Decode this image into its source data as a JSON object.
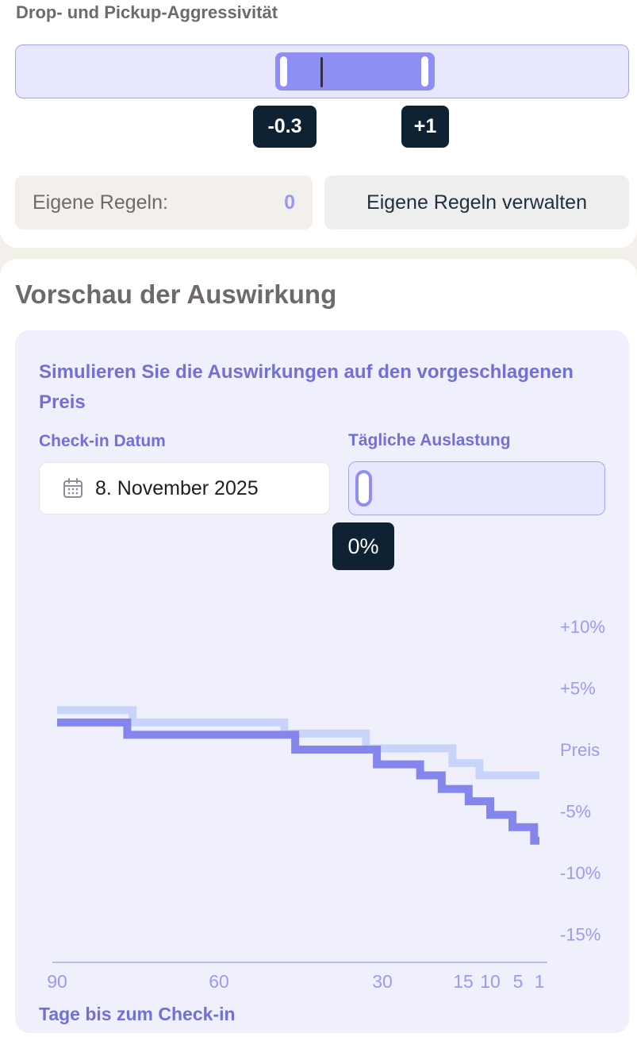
{
  "settings": {
    "aggressiveness_label": "Drop- und Pickup-Aggressivität",
    "range_min_value": "-0.3",
    "range_max_value": "+1",
    "custom_rules_label": "Eigene Regeln:",
    "custom_rules_count": "0",
    "manage_rules_button": "Eigene Regeln verwalten"
  },
  "preview": {
    "title": "Vorschau der Auswirkung",
    "heading": "Simulieren Sie die Auswirkungen auf den vorgeschlagenen Preis",
    "checkin_label": "Check-in Datum",
    "checkin_value": "8. November 2025",
    "calendar_icon": "calendar-icon",
    "occupancy_label": "Tägliche Auslastung",
    "occupancy_value": "0%",
    "occupancy_level": 0
  },
  "chart_data": {
    "type": "line",
    "xlabel": "Tage bis zum Check-in",
    "x_ticks": [
      "90",
      "60",
      "30",
      "15",
      "10",
      "5",
      "1"
    ],
    "y_ticks": [
      "+10%",
      "+5%",
      "Preis",
      "-5%",
      "-10%",
      "-15%"
    ],
    "x_domain": [
      90,
      1
    ],
    "ylim": [
      -15,
      10
    ],
    "series": [
      {
        "color": "#c9d4fb",
        "points": [
          [
            90,
            3.2
          ],
          [
            76,
            3.2
          ],
          [
            76,
            2.2
          ],
          [
            48,
            2.2
          ],
          [
            48,
            1.3
          ],
          [
            33,
            1.3
          ],
          [
            33,
            0.1
          ],
          [
            17,
            0.1
          ],
          [
            17,
            -1.1
          ],
          [
            12,
            -1.1
          ],
          [
            12,
            -2.1
          ],
          [
            1,
            -2.1
          ]
        ]
      },
      {
        "color": "#8585ee",
        "points": [
          [
            90,
            2.2
          ],
          [
            77,
            2.2
          ],
          [
            77,
            1.2
          ],
          [
            46,
            1.2
          ],
          [
            46,
            0.0
          ],
          [
            31,
            0.0
          ],
          [
            31,
            -1.2
          ],
          [
            23,
            -1.2
          ],
          [
            23,
            -2.1
          ],
          [
            19,
            -2.1
          ],
          [
            19,
            -3.2
          ],
          [
            14,
            -3.2
          ],
          [
            14,
            -4.2
          ],
          [
            10,
            -4.2
          ],
          [
            10,
            -5.3
          ],
          [
            6,
            -5.3
          ],
          [
            6,
            -6.3
          ],
          [
            2,
            -6.3
          ],
          [
            2,
            -7.4
          ],
          [
            1,
            -7.4
          ]
        ]
      }
    ]
  }
}
